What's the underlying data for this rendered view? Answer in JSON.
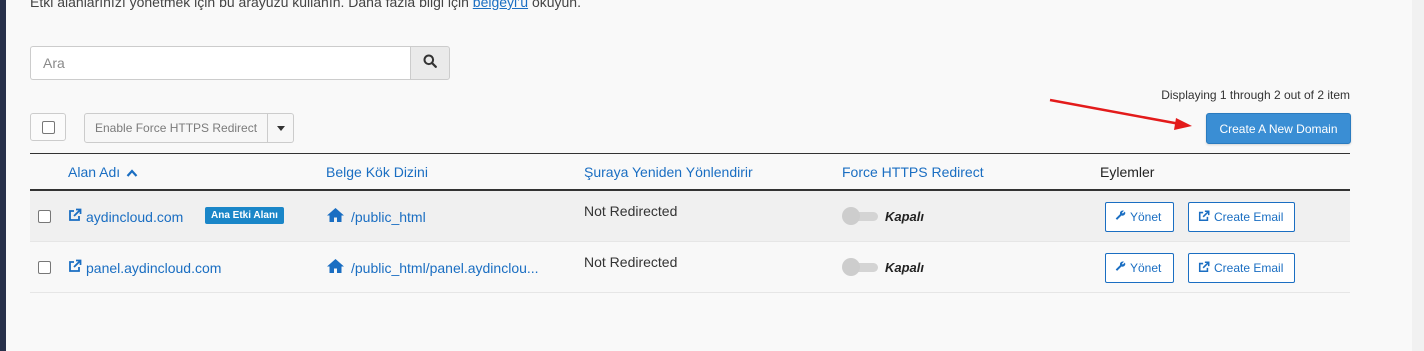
{
  "intro": {
    "text": "Etki alanlarınızı yönetmek için bu arayüzü kullanın. Daha fazla bilgi için ",
    "link_label": "belgeyi’ü",
    "suffix": " okuyun."
  },
  "search": {
    "placeholder": "Ara",
    "icon": "search-icon"
  },
  "pagination": {
    "displaying_text": "Displaying 1 through 2 out of 2 item"
  },
  "bulk": {
    "action_label": "Enable Force HTTPS Redirect"
  },
  "create_button": {
    "label": "Create A New Domain"
  },
  "table": {
    "headers": {
      "domain": "Alan Adı",
      "docroot": "Belge Kök Dizini",
      "redirect": "Şuraya Yeniden Yönlendirir",
      "https": "Force HTTPS Redirect",
      "actions": "Eylemler"
    },
    "rows": [
      {
        "domain": "aydincloud.com",
        "badge": "Ana Etki Alanı",
        "docroot": "/public_html",
        "redirect": "Not Redirected",
        "https_status": "Kapalı",
        "manage_label": "Yönet",
        "email_label": "Create Email"
      },
      {
        "domain": "panel.aydincloud.com",
        "docroot": "/public_html/panel.aydinclou...",
        "redirect": "Not Redirected",
        "https_status": "Kapalı",
        "manage_label": "Yönet",
        "email_label": "Create Email"
      }
    ]
  },
  "colors": {
    "accent": "#1a6ec2",
    "primary_button": "#3a8ed4",
    "badge": "#1a86c8",
    "annotation_arrow": "#e31b1b"
  }
}
